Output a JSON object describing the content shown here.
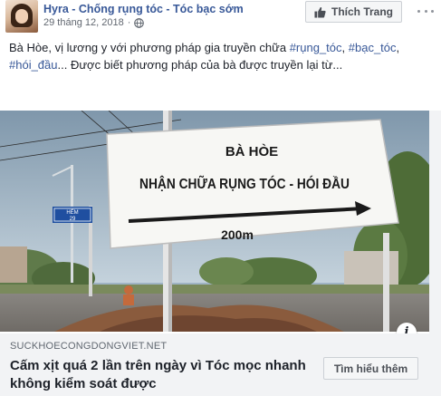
{
  "post": {
    "page_name": "Hyra - Chống rụng tóc - Tóc bạc sớm",
    "timestamp": "29 tháng 12, 2018",
    "separator": "·",
    "privacy_icon": "globe-icon",
    "like_page_label": "Thích Trang",
    "text_before": "Bà Hòe, vị lương y với phương pháp gia truyền chữa ",
    "tags": [
      "#rụng_tóc",
      "#bạc_tóc",
      "#hói_đầu"
    ],
    "text_after": "... Được biết phương pháp của bà được truyền lại từ..."
  },
  "image": {
    "sign_line1": "BÀ HÒE",
    "sign_line2": "NHẬN CHỮA RỤNG TÓC - HÓI ĐẦU",
    "sign_distance": "200m",
    "street_sign_line1": "HẺM",
    "street_sign_line2": "29",
    "info_icon": "i"
  },
  "link": {
    "domain": "SUCKHOECONGDONGVIET.NET",
    "headline": "Cấm xịt quá 2 lần trên ngày vì Tóc mọc nhanh không kiểm soát được",
    "cta_label": "Tìm hiểu thêm"
  },
  "colors": {
    "link_blue": "#385898",
    "secondary_text": "#616770",
    "link_box_bg": "#f2f3f5"
  }
}
